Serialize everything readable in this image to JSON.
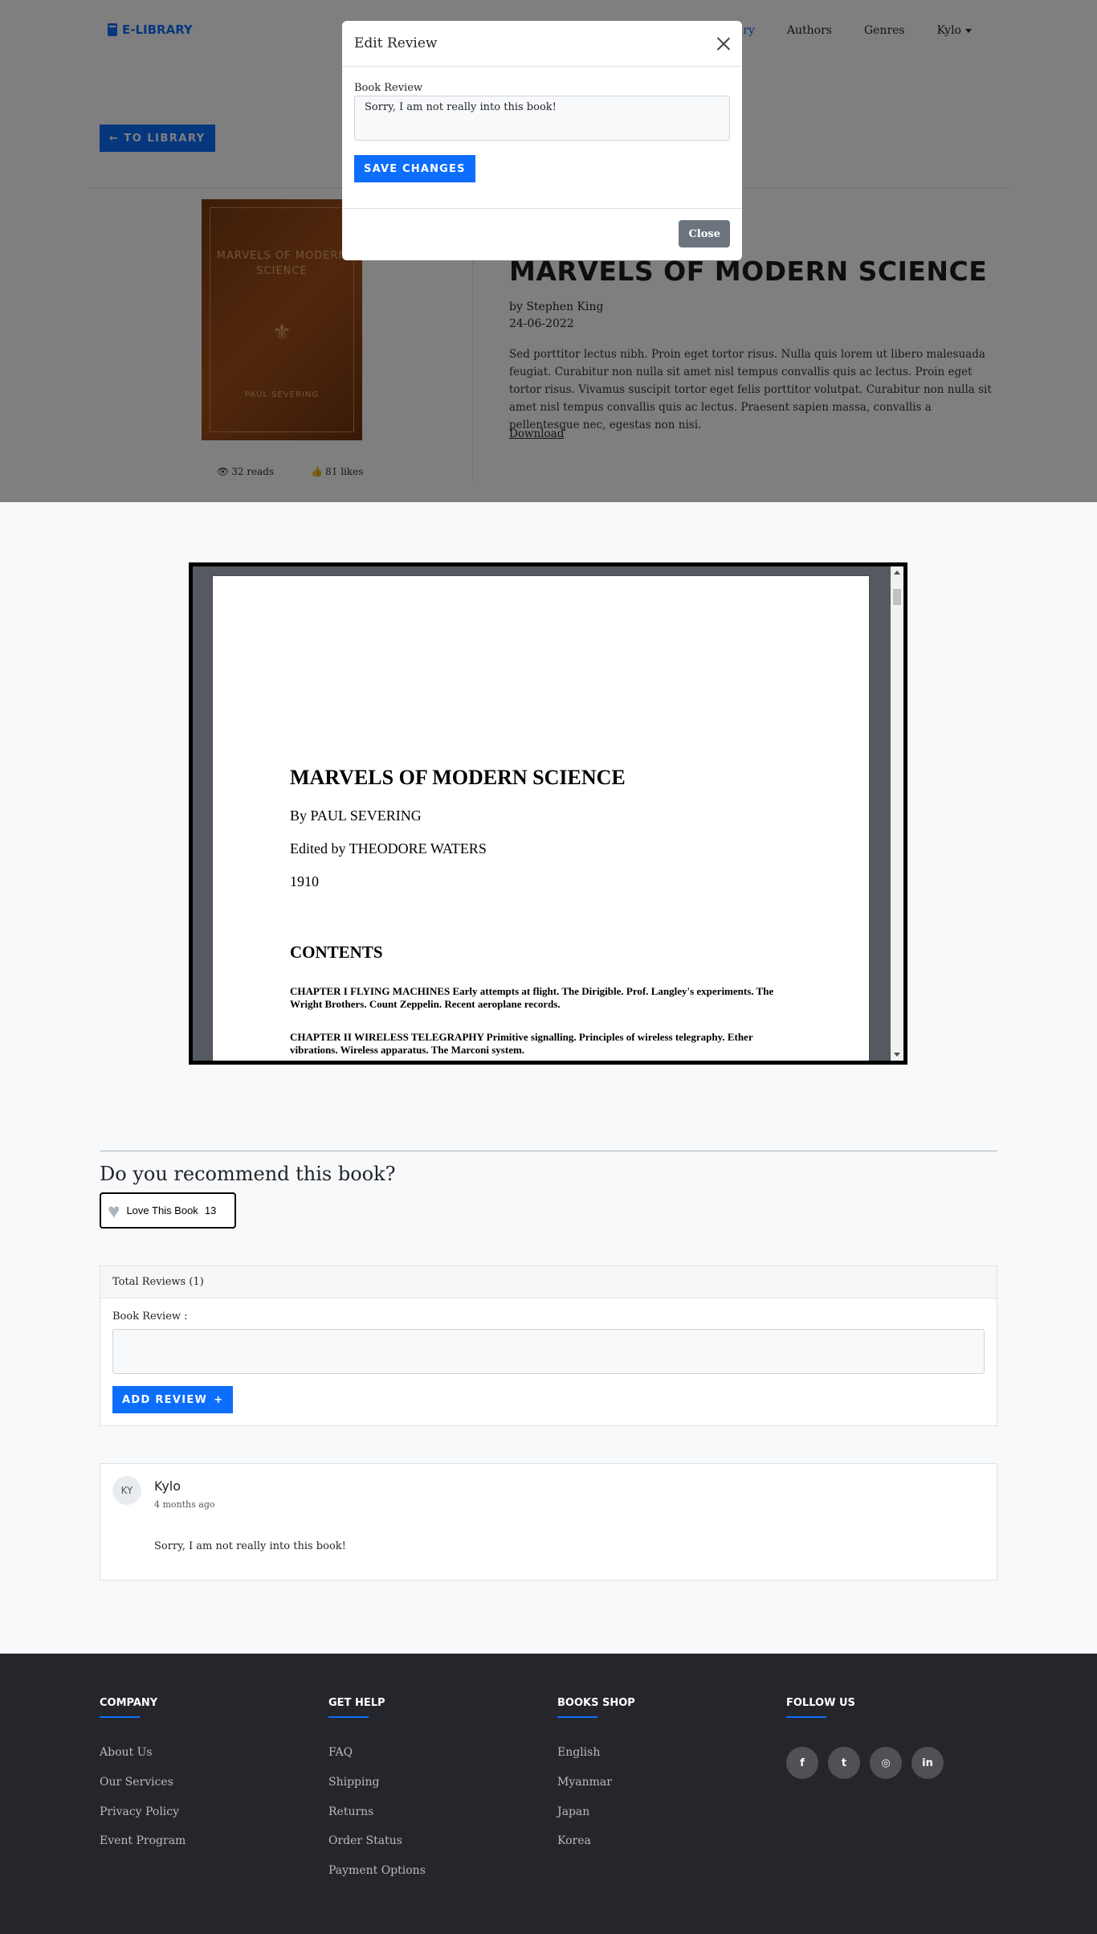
{
  "nav": {
    "brand": "E-LIBRARY",
    "links": [
      {
        "label": "Library",
        "active": true
      },
      {
        "label": "Authors"
      },
      {
        "label": "Genres"
      },
      {
        "label": "Kylo"
      }
    ]
  },
  "book": {
    "back_label": "TO LIBRARY",
    "cover": {
      "title": "MARVELS OF MODERN SCIENCE",
      "author": "PAUL SEVERING"
    },
    "reads": "32 reads",
    "likes": "81 likes",
    "title": "MARVELS OF MODERN SCIENCE",
    "by": "by Stephen King",
    "date": "24-06-2022",
    "description": "Sed porttitor lectus nibh. Proin eget tortor risus. Nulla quis lorem ut libero malesuada feugiat. Curabitur non nulla sit amet nisl tempus convallis quis ac lectus. Proin eget tortor risus. Vivamus suscipit tortor eget felis porttitor volutpat. Curabitur non nulla sit amet nisl tempus convallis quis ac lectus. Praesent sapien massa, convallis a pellentesque nec, egestas non nisi.",
    "download_label": "Download"
  },
  "modal": {
    "title": "Edit Review",
    "label": "Book Review",
    "value": "Sorry, I am not really into this book!",
    "save_label": "SAVE CHANGES",
    "close_label": "Close"
  },
  "pdf": {
    "title": "MARVELS OF MODERN SCIENCE",
    "by": "By PAUL SEVERING",
    "edited": "Edited by THEODORE WATERS",
    "year": "1910",
    "contents": "CONTENTS",
    "chapter1": "CHAPTER I FLYING MACHINES Early attempts at flight. The Dirigible. Prof. Langley's experiments. The Wright Brothers. Count Zeppelin. Recent aeroplane records.",
    "chapter2": "CHAPTER II WIRELESS TELEGRAPHY Primitive signalling. Principles of wireless telegraphy. Ether vibrations. Wireless apparatus. The Marconi system."
  },
  "recommend": {
    "title": "Do you recommend this book?",
    "love_label": "Love This Book",
    "love_count": "13"
  },
  "review_form": {
    "header": "Total Reviews (1)",
    "label": "Book Review :",
    "add_label": "ADD REVIEW"
  },
  "review": {
    "initials": "KY",
    "name": "Kylo",
    "time": "4 months ago",
    "text": "Sorry, I am not really into this book!"
  },
  "footer": {
    "columns": [
      {
        "heading": "COMPANY",
        "links": [
          "About Us",
          "Our Services",
          "Privacy Policy",
          "Event Program"
        ]
      },
      {
        "heading": "GET HELP",
        "links": [
          "FAQ",
          "Shipping",
          "Returns",
          "Order Status",
          "Payment Options"
        ]
      },
      {
        "heading": "BOOKS SHOP",
        "links": [
          "English",
          "Myanmar",
          "Japan",
          "Korea"
        ]
      },
      {
        "heading": "FOLLOW US",
        "links": []
      }
    ],
    "social": [
      "facebook-icon",
      "twitter-icon",
      "instagram-icon",
      "linkedin-icon"
    ]
  },
  "colors": {
    "primary": "#0d6efd",
    "footer": "#24262b",
    "secondary": "#6c757d"
  }
}
